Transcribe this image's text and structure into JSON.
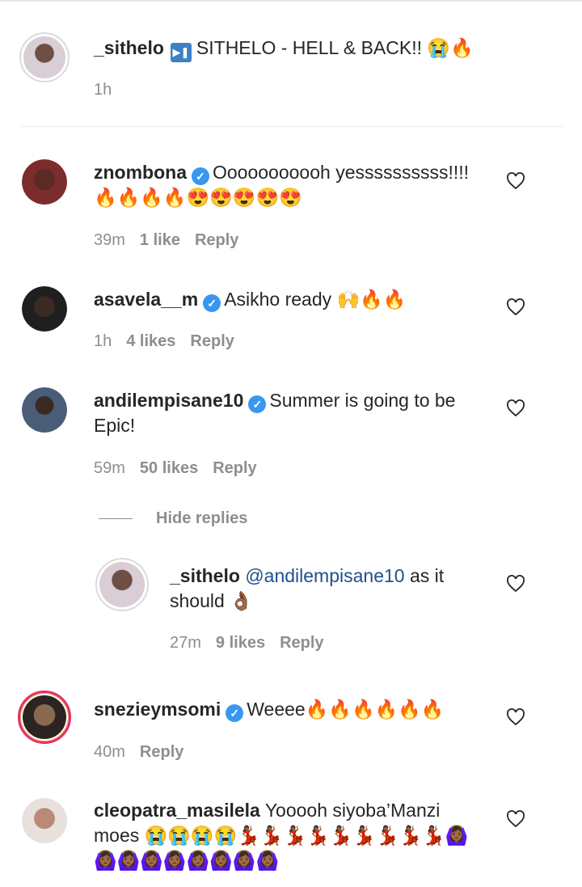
{
  "comments": [
    {
      "username": "_sithelo",
      "text": "SITHELO - HELL & BACK!! 😭🔥",
      "play_icon": "play-pause-button-icon",
      "time": "1h",
      "avatar_color": "#c9b9c2"
    },
    {
      "username": "znombona",
      "verified": true,
      "text": "Ooooooooooh yessssssssss!!!! 🔥🔥🔥🔥😍😍😍😍😍",
      "time": "39m",
      "likes": "1 like",
      "reply": "Reply",
      "avatar_color": "#7b2c2c"
    },
    {
      "username": "asavela__m",
      "verified": true,
      "text": "Asikho ready 🙌🔥🔥",
      "time": "1h",
      "likes": "4 likes",
      "reply": "Reply",
      "avatar_color": "#3b2a22"
    },
    {
      "username": "andilempisane10",
      "verified": true,
      "text": "Summer is going to be Epic!",
      "time": "59m",
      "likes": "50 likes",
      "reply": "Reply",
      "hide_replies": "Hide replies",
      "avatar_color": "#4a5d78"
    },
    {
      "username": "_sithelo",
      "mention": "@andilempisane10",
      "text": "as it should 👌🏾",
      "time": "27m",
      "likes": "9 likes",
      "reply": "Reply",
      "avatar_color": "#c9b9c2"
    },
    {
      "username": "snezieymsomi",
      "verified": true,
      "text": "Weeee🔥🔥🔥🔥🔥🔥",
      "time": "40m",
      "reply": "Reply",
      "avatar_color": "#8a6a4f"
    },
    {
      "username": "cleopatra_masilela",
      "text": "Yooooh siyoba’Manzi moes 😭😭😭😭💃🏾💃🏾💃🏾💃🏾💃🏾💃🏾💃🏾💃🏾💃🏾🙆🏾‍♀️🙆🏾‍♀️🙆🏾‍♀️🙆🏾‍♀️🙆🏾‍♀️🙆🏾‍♀️🙆🏾‍♀️🙆🏾‍♀️🙆🏾‍♀️",
      "avatar_color": "#b98a78"
    }
  ],
  "colors": {
    "verified": "#3897f0",
    "meta": "#8e8e8e",
    "mention": "#1e4f8c",
    "story_ring": "#e1306c"
  }
}
